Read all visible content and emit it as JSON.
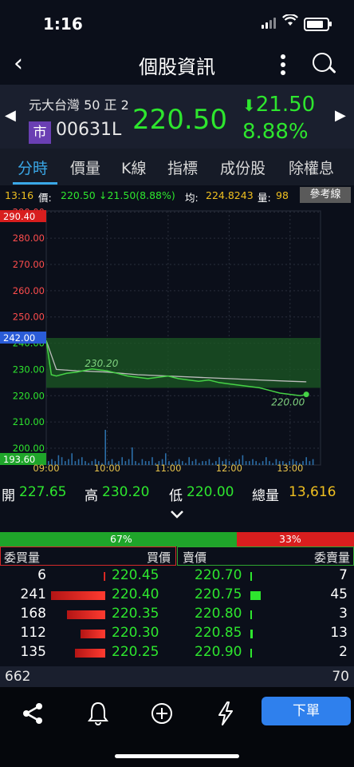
{
  "status": {
    "time": "1:16"
  },
  "nav": {
    "title": "個股資訊"
  },
  "stock": {
    "name": "元大台灣 50 正 2",
    "market_badge": "市",
    "code": "00631L",
    "price": "220.50",
    "change": "21.50",
    "change_pct": "8.88%"
  },
  "tabs": [
    "分時",
    "價量",
    "K線",
    "指標",
    "成份股",
    "除權息"
  ],
  "info": {
    "time": "13:16",
    "price_label": "價:",
    "price": "220.50",
    "change": "21.50(8.88%)",
    "avg_label": "均:",
    "avg": "224.8243",
    "vol_label": "量:",
    "vol": "98",
    "ref_button": "參考線"
  },
  "chart_data": {
    "type": "line",
    "x_ticks": [
      "09:00",
      "10:00",
      "11:00",
      "12:00",
      "13:00"
    ],
    "y_ticks": [
      "290.00",
      "280.00",
      "270.00",
      "260.00",
      "250.00",
      "240.00",
      "230.00",
      "220.00",
      "210.00",
      "200.00"
    ],
    "y_top_label": "290.40",
    "y_ref_label": "242.00",
    "y_bottom_label": "193.60",
    "ylim": [
      193.6,
      290.4
    ],
    "reference": 242.0,
    "high_label": "230.20",
    "low_label": "220.00",
    "series": [
      {
        "x": [
          0,
          5,
          10,
          20,
          30,
          45,
          60,
          70,
          80,
          90,
          100,
          110,
          120,
          130,
          140,
          150,
          160,
          170,
          180,
          190,
          200,
          210,
          220,
          230,
          240,
          250,
          256
        ],
        "values": [
          241,
          228,
          227.5,
          228.5,
          229,
          230.2,
          229.5,
          228.5,
          227.5,
          227,
          226.5,
          227,
          227.5,
          226.5,
          226,
          225.5,
          226,
          225,
          224.5,
          224,
          223.5,
          223,
          222,
          221,
          220.5,
          220,
          220.5
        ]
      },
      {
        "x": [
          0,
          10,
          30,
          60,
          90,
          120,
          150,
          180,
          210,
          240,
          256
        ],
        "values": [
          241,
          230,
          229.5,
          229,
          228,
          227.5,
          227,
          226.5,
          226,
          225.5,
          225.3
        ]
      }
    ],
    "volume": [
      2,
      3,
      2,
      5,
      4,
      2,
      3,
      6,
      2,
      3,
      4,
      2,
      1,
      2,
      3,
      2,
      1,
      18,
      2,
      3,
      1,
      2,
      4,
      2,
      3,
      9,
      2,
      1,
      3,
      2,
      2,
      4,
      1,
      2,
      3,
      6,
      2,
      1,
      2,
      3,
      2,
      1,
      4,
      2,
      3,
      1,
      2,
      2,
      3,
      1,
      2,
      4,
      2,
      3,
      2,
      1,
      2,
      3,
      5,
      2,
      2,
      3,
      2,
      1,
      2,
      4,
      2,
      1,
      3,
      2,
      2,
      1,
      2,
      3,
      2,
      1,
      2,
      4,
      2,
      3
    ]
  },
  "ohlc": {
    "open_label": "開",
    "open": "227.65",
    "high_label": "高",
    "high": "230.20",
    "low_label": "低",
    "low": "220.00",
    "vol_label": "總量",
    "vol": "13,616"
  },
  "ratio": {
    "buy_pct": "67%",
    "sell_pct": "33%",
    "buy_fraction": 0.67
  },
  "book": {
    "headers": {
      "bid_qty": "委買量",
      "bid_price": "買價",
      "ask_price": "賣價",
      "ask_qty": "委賣量"
    },
    "rows": [
      {
        "bid_qty": "6",
        "bid_price": "220.45",
        "ask_price": "220.70",
        "ask_qty": "7",
        "bid_bar": 0.02,
        "ask_bar": 0.02
      },
      {
        "bid_qty": "241",
        "bid_price": "220.40",
        "ask_price": "220.75",
        "ask_qty": "45",
        "bid_bar": 1.0,
        "ask_bar": 0.19
      },
      {
        "bid_qty": "168",
        "bid_price": "220.35",
        "ask_price": "220.80",
        "ask_qty": "3",
        "bid_bar": 0.7,
        "ask_bar": 0.02
      },
      {
        "bid_qty": "112",
        "bid_price": "220.30",
        "ask_price": "220.85",
        "ask_qty": "13",
        "bid_bar": 0.46,
        "ask_bar": 0.05
      },
      {
        "bid_qty": "135",
        "bid_price": "220.25",
        "ask_price": "220.90",
        "ask_qty": "2",
        "bid_bar": 0.56,
        "ask_bar": 0.01
      }
    ],
    "bid_total": "662",
    "ask_total": "70"
  },
  "toolbar": {
    "order_label": "下單"
  },
  "colors": {
    "up": "#2ee62e",
    "down": "#ff3b30",
    "accent": "#3aa8e8"
  }
}
